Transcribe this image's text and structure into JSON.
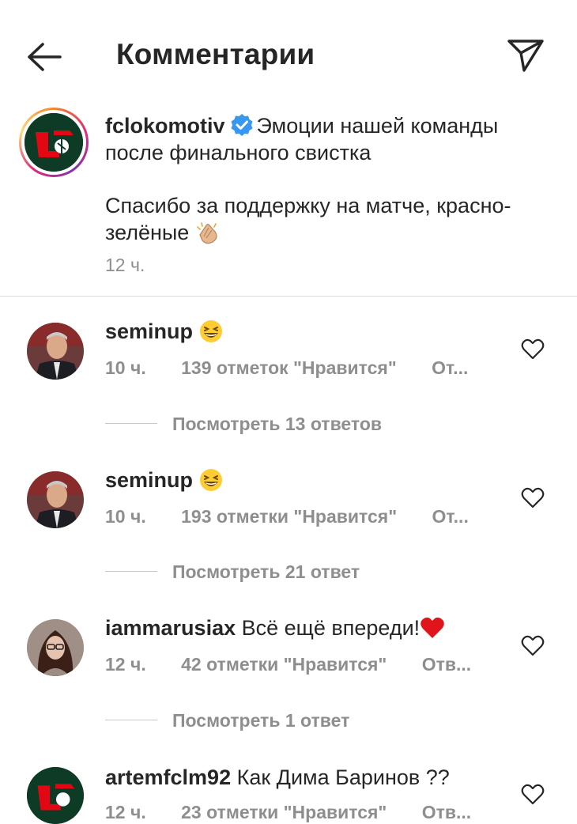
{
  "header": {
    "title": "Комментарии",
    "back_icon": "arrow-left-icon",
    "share_icon": "paper-plane-icon"
  },
  "post": {
    "username": "fclokomotiv",
    "caption_line1": "Эмоции нашей команды после финального свистка",
    "caption_line2": "Спасибо за поддержку на матче, красно-зелёные",
    "caption_emoji": "clapping-hands-emoji",
    "time": "12 ч.",
    "colors": {
      "ring_start": "#f58529",
      "ring_mid": "#dd2a7b",
      "verified": "#3897f0"
    }
  },
  "comments": [
    {
      "username": "seminup",
      "text": "",
      "emoji": "laughing-emoji",
      "time": "10 ч.",
      "likes": "139 отметок \"Нравится\"",
      "reply": "От...",
      "replies": "Посмотреть 13 ответов"
    },
    {
      "username": "seminup",
      "text": "",
      "emoji": "laughing-emoji",
      "time": "10 ч.",
      "likes": "193 отметки \"Нравится\"",
      "reply": "От...",
      "replies": "Посмотреть 21 ответ"
    },
    {
      "username": "iammarusiax",
      "text": "Всё ещё впереди!",
      "emoji": "red-heart-emoji",
      "time": "12 ч.",
      "likes": "42 отметки \"Нравится\"",
      "reply": "Отв...",
      "replies": "Посмотреть 1 ответ"
    },
    {
      "username": "artemfclm92",
      "text": "Как Дима Баринов ??",
      "emoji": "",
      "time": "12 ч.",
      "likes": "23 отметки \"Нравится\"",
      "reply": "Отв..."
    }
  ]
}
